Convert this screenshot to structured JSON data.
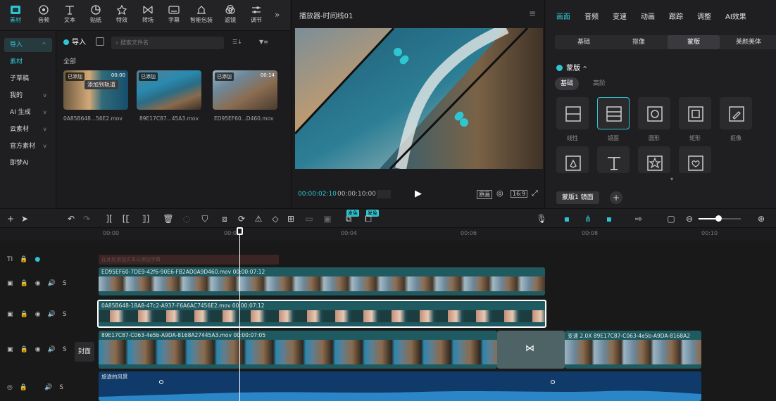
{
  "top_toolbar": {
    "items": [
      {
        "label": "素材",
        "icon": "media-icon"
      },
      {
        "label": "音频",
        "icon": "audio-icon"
      },
      {
        "label": "文本",
        "icon": "text-icon"
      },
      {
        "label": "贴纸",
        "icon": "sticker-icon"
      },
      {
        "label": "特效",
        "icon": "effects-icon"
      },
      {
        "label": "转场",
        "icon": "transition-icon"
      },
      {
        "label": "字幕",
        "icon": "caption-icon"
      },
      {
        "label": "智能包装",
        "icon": "smart-package-icon"
      },
      {
        "label": "滤镜",
        "icon": "filter-icon"
      },
      {
        "label": "调节",
        "icon": "adjust-icon"
      }
    ],
    "more": "»"
  },
  "sidebar": {
    "items": [
      {
        "label": "导入"
      },
      {
        "label": "素材"
      },
      {
        "label": "子草稿"
      },
      {
        "label": "我的"
      },
      {
        "label": "AI 生成"
      },
      {
        "label": "云素材"
      },
      {
        "label": "官方素材"
      },
      {
        "label": "即梦AI"
      }
    ]
  },
  "media": {
    "import_label": "导入",
    "search_placeholder": "搜索文件名",
    "sort_label": "☰↓",
    "filter_label": "▼≡",
    "all_label": "全部",
    "added_badge": "已添加",
    "tooltip": "添加到轨道",
    "items": [
      {
        "name": "0A85B648...56E2.mov",
        "duration": "00:00"
      },
      {
        "name": "89E17C87...45A3.mov",
        "duration": ""
      },
      {
        "name": "ED95EF60...D460.mov",
        "duration": "00:14"
      }
    ]
  },
  "player": {
    "title": "播放器-时间线01",
    "current_time": "00:00:02:10",
    "total_time": "00:00:10:00",
    "original_label": "原画",
    "ratio_label": "16:9"
  },
  "right_panel": {
    "tabs": [
      "画面",
      "音频",
      "变速",
      "动画",
      "跟踪",
      "调整",
      "AI效果"
    ],
    "sub_tabs": [
      "基础",
      "抠像",
      "蒙版",
      "美颜美体"
    ],
    "mask_header": "蒙版",
    "segments": [
      "基础",
      "高阶"
    ],
    "masks": [
      {
        "label": "线性"
      },
      {
        "label": "镜面"
      },
      {
        "label": "圆形"
      },
      {
        "label": "矩形"
      },
      {
        "label": "抠像"
      }
    ],
    "footer_label": "蒙版1 镜面"
  },
  "timeline": {
    "ruler": [
      "00:00",
      "00:02",
      "00:04",
      "00:06",
      "00:08",
      "00:10"
    ],
    "text_track_placeholder": "在此处添加文本以添加字幕",
    "clips": [
      {
        "name": "ED95EF60-7DE9-42f6-90E6-FB2AD0A9D460.mov",
        "duration": "00:00:07:12"
      },
      {
        "name": "0A85B648-18A8-47c2-A937-F6A6AC7456E2.mov",
        "duration": "00:00:07:12"
      },
      {
        "name": "89E17C87-C063-4e5b-A9DA-8168A27445A3.mov",
        "duration": "00:00:07:05"
      },
      {
        "name": "89E17C87-C063-4e5b-A9DA-8168A2",
        "speed_badge": "变速 2.0X"
      }
    ],
    "audio_name": "旅途的风景",
    "cover_label": "封面",
    "badges": [
      "发免",
      "发免"
    ],
    "track_labels": [
      "S",
      "S",
      "S",
      "S"
    ]
  }
}
